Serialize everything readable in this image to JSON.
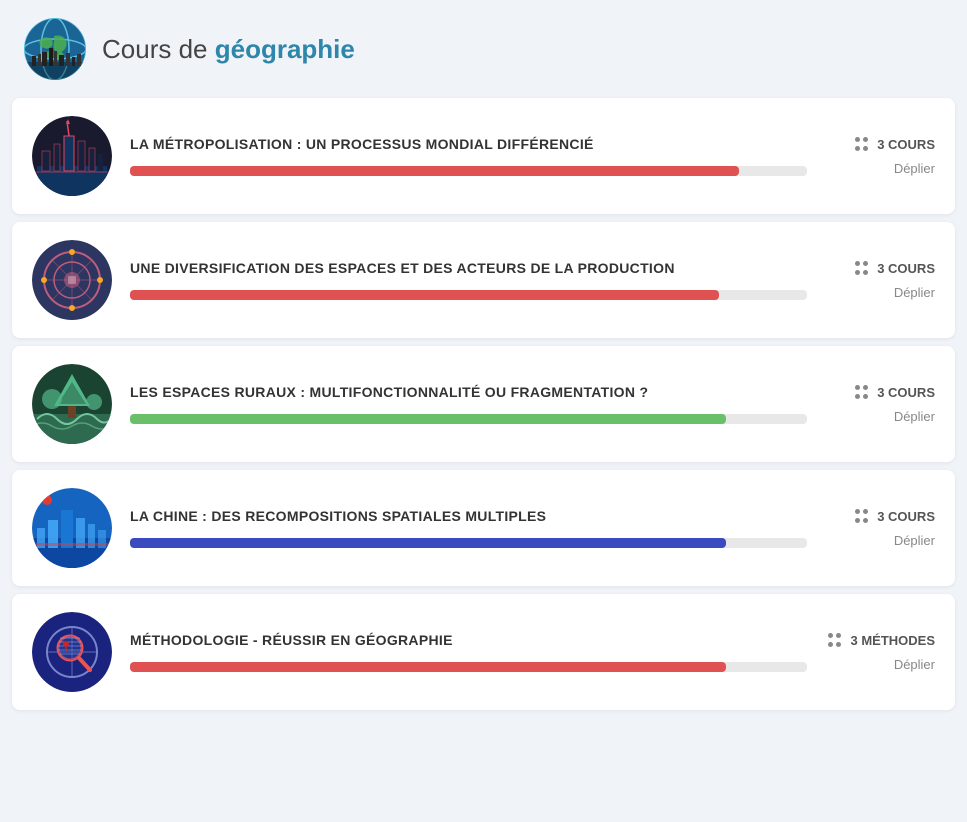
{
  "header": {
    "title_plain": "Cours de ",
    "title_bold": "géographie",
    "globe_label": "Globe icon"
  },
  "courses": [
    {
      "id": "metropolisation",
      "title": "LA MÉTROPOLISATION : UN PROCESSUS MONDIAL DIFFÉRENCIÉ",
      "count_label": "3 COURS",
      "progress": 90,
      "bar_color": "#e05252",
      "deploy_label": "Déplier",
      "thumb_color1": "#1a1a2e",
      "thumb_color2": "#16213e"
    },
    {
      "id": "diversification",
      "title": "UNE DIVERSIFICATION DES ESPACES ET DES ACTEURS DE LA PRODUCTION",
      "count_label": "3 COURS",
      "progress": 87,
      "bar_color": "#e05252",
      "deploy_label": "Déplier",
      "thumb_color1": "#2d3561",
      "thumb_color2": "#c05c7e"
    },
    {
      "id": "ruraux",
      "title": "LES ESPACES RURAUX : MULTIFONCTIONNALITÉ OU FRAGMENTATION ?",
      "count_label": "3 COURS",
      "progress": 88,
      "bar_color": "#6abf69",
      "deploy_label": "Déplier",
      "thumb_color1": "#2d6a4f",
      "thumb_color2": "#52b788"
    },
    {
      "id": "chine",
      "title": "LA CHINE : DES RECOMPOSITIONS SPATIALES MULTIPLES",
      "count_label": "3 COURS",
      "progress": 88,
      "bar_color": "#3a4abf",
      "deploy_label": "Déplier",
      "thumb_color1": "#1565c0",
      "thumb_color2": "#e65100"
    },
    {
      "id": "methodologie",
      "title": "MÉTHODOLOGIE - RÉUSSIR EN GÉOGRAPHIE",
      "count_label": "3 MÉTHODES",
      "progress": 88,
      "bar_color": "#e05252",
      "deploy_label": "Déplier",
      "thumb_color1": "#1a237e",
      "thumb_color2": "#c62828"
    }
  ]
}
